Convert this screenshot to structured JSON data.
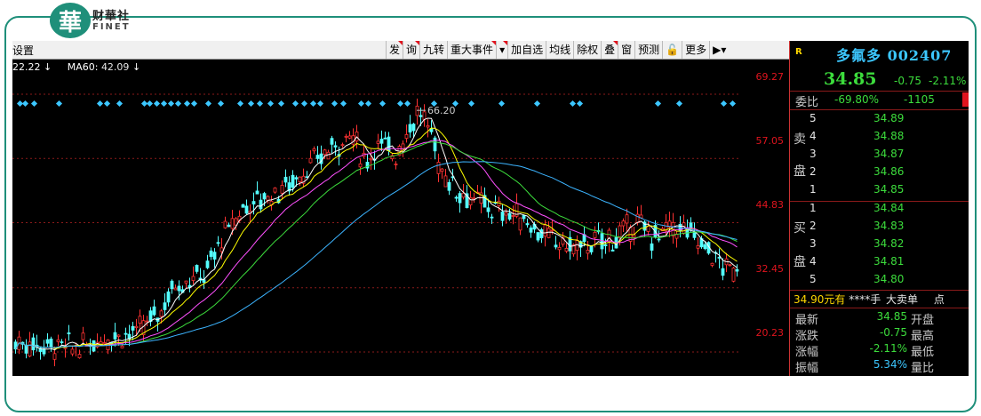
{
  "logo": {
    "mark": "華",
    "cn": "财華社",
    "en": "FINET"
  },
  "toolbar": {
    "left_label": "设置",
    "buttons": [
      "发",
      "询",
      "九转",
      "重大事件",
      "▾",
      "加自选",
      "均线",
      "除权",
      "叠",
      "窗",
      "预测",
      "🔓",
      "更多",
      "▶▾"
    ]
  },
  "ma": {
    "ma_a": "22.22",
    "ma60_label": "MA60:",
    "ma60_value": "42.09",
    "arrow": "↓"
  },
  "chart": {
    "price_levels": [
      "69.27",
      "57.05",
      "44.83",
      "32.45",
      "20.23"
    ],
    "peak_label": "66.20"
  },
  "chart_data": {
    "type": "line",
    "price_levels": [
      69.27,
      57.05,
      44.83,
      32.45,
      20.23
    ],
    "peak": 66.2
  },
  "quote": {
    "r": "R",
    "name": "多氟多",
    "code": "002407",
    "price": "34.85",
    "change": "-0.75",
    "pct": "-2.11%",
    "wb_label": "委比",
    "wb_pct": "-69.80%",
    "wb_vol": "-1105",
    "sell_label": [
      "卖",
      "盘"
    ],
    "buy_label": [
      "买",
      "盘"
    ],
    "sell": [
      {
        "lvl": "5",
        "price": "34.89"
      },
      {
        "lvl": "4",
        "price": "34.88"
      },
      {
        "lvl": "3",
        "price": "34.87"
      },
      {
        "lvl": "2",
        "price": "34.86"
      },
      {
        "lvl": "1",
        "price": "34.85"
      }
    ],
    "buy": [
      {
        "lvl": "1",
        "price": "34.84"
      },
      {
        "lvl": "2",
        "price": "34.83"
      },
      {
        "lvl": "3",
        "price": "34.82"
      },
      {
        "lvl": "4",
        "price": "34.81"
      },
      {
        "lvl": "5",
        "price": "34.80"
      }
    ],
    "big_order": {
      "price": "34.90元有",
      "qty": "****手",
      "label": "大卖单",
      "tail": "点"
    },
    "stats": [
      {
        "k": "最新",
        "v": "34.85",
        "k2": "开盘"
      },
      {
        "k": "涨跌",
        "v": "-0.75",
        "k2": "最高"
      },
      {
        "k": "涨幅",
        "v": "-2.11%",
        "k2": "最低"
      },
      {
        "k": "振幅",
        "v": "5.34%",
        "k2": "量比"
      }
    ]
  }
}
